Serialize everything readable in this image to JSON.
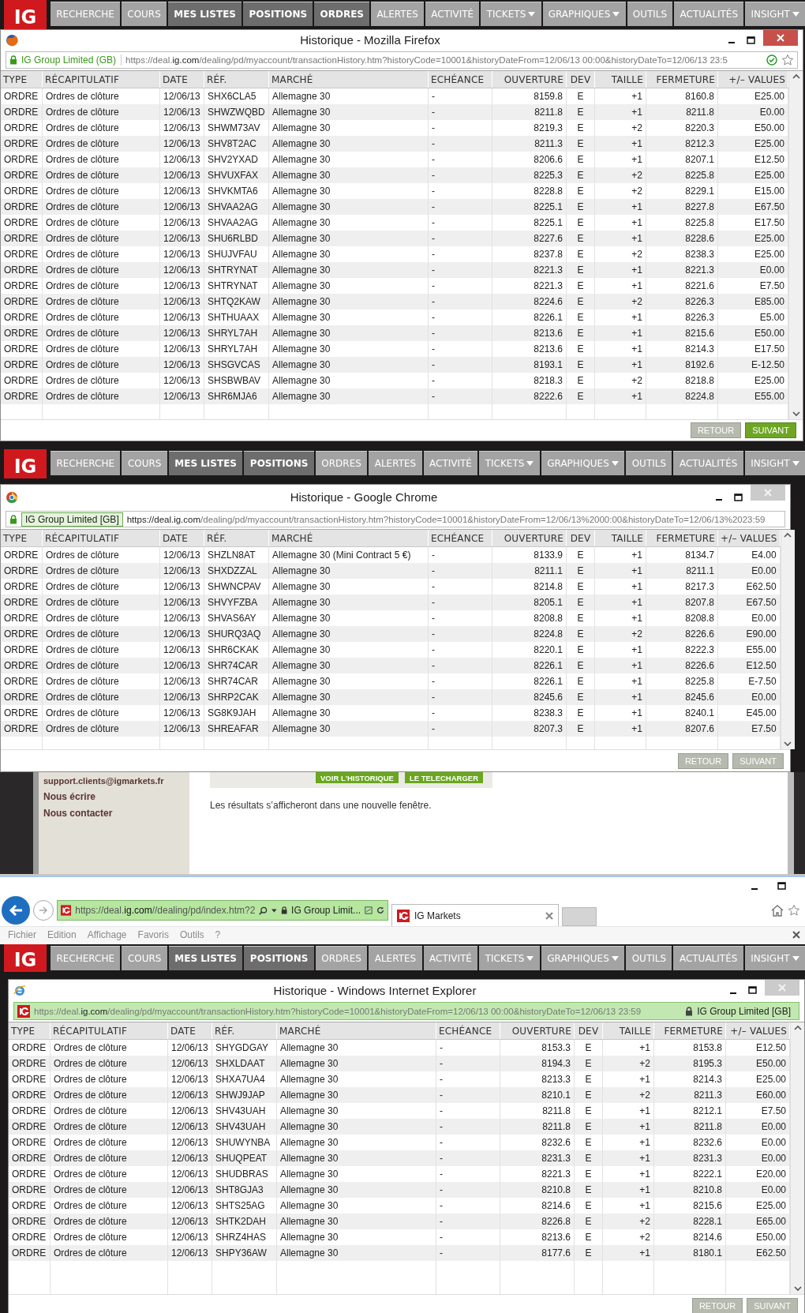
{
  "firefox_window": {
    "kind": "firefox",
    "logo": "IG",
    "nav": [
      {
        "label": "RECHERCHE",
        "kind": "light",
        "dropdown": false
      },
      {
        "label": "COURS",
        "kind": "light",
        "dropdown": false
      },
      {
        "label": "MES LISTES",
        "kind": "dark",
        "dropdown": false
      },
      {
        "label": "POSITIONS",
        "kind": "dark",
        "dropdown": false
      },
      {
        "label": "ORDRES",
        "kind": "dark",
        "dropdown": false
      },
      {
        "label": "ALERTES",
        "kind": "light",
        "dropdown": false
      },
      {
        "label": "ACTIVITÉ",
        "kind": "light",
        "dropdown": false
      },
      {
        "label": "TICKETS",
        "kind": "light",
        "dropdown": true
      },
      {
        "label": "GRAPHIQUES",
        "kind": "light",
        "dropdown": true
      },
      {
        "label": "OUTILS",
        "kind": "light",
        "dropdown": false
      },
      {
        "label": "ACTUALITÉS",
        "kind": "light",
        "dropdown": false
      },
      {
        "label": "INSIGHT",
        "kind": "light",
        "dropdown": true
      }
    ],
    "title": "Historique - Mozilla Firefox",
    "identity": "IG Group Limited (GB)",
    "url": "https://deal.**ig.com**/dealing/pd/myaccount/transactionHistory.htm?historyCode=10001&historyDateFrom=12/06/13 00:00&historyDateTo=12/06/13 23:5",
    "columns": [
      "TYPE",
      "RÉCAPITULATIF",
      "DATE",
      "RÉF.",
      "MARCHÉ",
      "ECHÉANCE",
      "OUVERTURE",
      "DEV",
      "TAILLE",
      "FERMETURE",
      "+/– VALUES"
    ],
    "rows": [
      [
        "ORDRE",
        "Ordres de clôture",
        "12/06/13",
        "SHX6CLA5",
        "Allemagne 30",
        "-",
        "8159.8",
        "E",
        "+1",
        "8160.8",
        "E25.00"
      ],
      [
        "ORDRE",
        "Ordres de clôture",
        "12/06/13",
        "SHWZWQBD",
        "Allemagne 30",
        "-",
        "8211.8",
        "E",
        "+1",
        "8211.8",
        "E0.00"
      ],
      [
        "ORDRE",
        "Ordres de clôture",
        "12/06/13",
        "SHWM73AV",
        "Allemagne 30",
        "-",
        "8219.3",
        "E",
        "+2",
        "8220.3",
        "E50.00"
      ],
      [
        "ORDRE",
        "Ordres de clôture",
        "12/06/13",
        "SHV8T2AC",
        "Allemagne 30",
        "-",
        "8211.3",
        "E",
        "+1",
        "8212.3",
        "E25.00"
      ],
      [
        "ORDRE",
        "Ordres de clôture",
        "12/06/13",
        "SHV2YXAD",
        "Allemagne 30",
        "-",
        "8206.6",
        "E",
        "+1",
        "8207.1",
        "E12.50"
      ],
      [
        "ORDRE",
        "Ordres de clôture",
        "12/06/13",
        "SHVUXFAX",
        "Allemagne 30",
        "-",
        "8225.3",
        "E",
        "+2",
        "8225.8",
        "E25.00"
      ],
      [
        "ORDRE",
        "Ordres de clôture",
        "12/06/13",
        "SHVKMTA6",
        "Allemagne 30",
        "-",
        "8228.8",
        "E",
        "+2",
        "8229.1",
        "E15.00"
      ],
      [
        "ORDRE",
        "Ordres de clôture",
        "12/06/13",
        "SHVAA2AG",
        "Allemagne 30",
        "-",
        "8225.1",
        "E",
        "+1",
        "8227.8",
        "E67.50"
      ],
      [
        "ORDRE",
        "Ordres de clôture",
        "12/06/13",
        "SHVAA2AG",
        "Allemagne 30",
        "-",
        "8225.1",
        "E",
        "+1",
        "8225.8",
        "E17.50"
      ],
      [
        "ORDRE",
        "Ordres de clôture",
        "12/06/13",
        "SHU6RLBD",
        "Allemagne 30",
        "-",
        "8227.6",
        "E",
        "+1",
        "8228.6",
        "E25.00"
      ],
      [
        "ORDRE",
        "Ordres de clôture",
        "12/06/13",
        "SHUJVFAU",
        "Allemagne 30",
        "-",
        "8237.8",
        "E",
        "+2",
        "8238.3",
        "E25.00"
      ],
      [
        "ORDRE",
        "Ordres de clôture",
        "12/06/13",
        "SHTRYNAT",
        "Allemagne 30",
        "-",
        "8221.3",
        "E",
        "+1",
        "8221.3",
        "E0.00"
      ],
      [
        "ORDRE",
        "Ordres de clôture",
        "12/06/13",
        "SHTRYNAT",
        "Allemagne 30",
        "-",
        "8221.3",
        "E",
        "+1",
        "8221.6",
        "E7.50"
      ],
      [
        "ORDRE",
        "Ordres de clôture",
        "12/06/13",
        "SHTQ2KAW",
        "Allemagne 30",
        "-",
        "8224.6",
        "E",
        "+2",
        "8226.3",
        "E85.00"
      ],
      [
        "ORDRE",
        "Ordres de clôture",
        "12/06/13",
        "SHTHUAAX",
        "Allemagne 30",
        "-",
        "8226.1",
        "E",
        "+1",
        "8226.3",
        "E5.00"
      ],
      [
        "ORDRE",
        "Ordres de clôture",
        "12/06/13",
        "SHRYL7AH",
        "Allemagne 30",
        "-",
        "8213.6",
        "E",
        "+1",
        "8215.6",
        "E50.00"
      ],
      [
        "ORDRE",
        "Ordres de clôture",
        "12/06/13",
        "SHRYL7AH",
        "Allemagne 30",
        "-",
        "8213.6",
        "E",
        "+1",
        "8214.3",
        "E17.50"
      ],
      [
        "ORDRE",
        "Ordres de clôture",
        "12/06/13",
        "SHSGVCAS",
        "Allemagne 30",
        "-",
        "8193.1",
        "E",
        "+1",
        "8192.6",
        "E-12.50"
      ],
      [
        "ORDRE",
        "Ordres de clôture",
        "12/06/13",
        "SHSBWBAV",
        "Allemagne 30",
        "-",
        "8218.3",
        "E",
        "+2",
        "8218.8",
        "E25.00"
      ],
      [
        "ORDRE",
        "Ordres de clôture",
        "12/06/13",
        "SHR6MJA6",
        "Allemagne 30",
        "-",
        "8222.6",
        "E",
        "+1",
        "8224.8",
        "E55.00"
      ]
    ],
    "buttons": [
      {
        "label": "RETOUR",
        "primary": false
      },
      {
        "label": "SUIVANT",
        "primary": true
      }
    ]
  },
  "chrome_window": {
    "kind": "chrome",
    "logo": "IG",
    "nav": [
      {
        "label": "RECHERCHE",
        "kind": "light",
        "dropdown": false
      },
      {
        "label": "COURS",
        "kind": "light",
        "dropdown": false
      },
      {
        "label": "MES LISTES",
        "kind": "dark",
        "dropdown": false
      },
      {
        "label": "POSITIONS",
        "kind": "dark",
        "dropdown": false
      },
      {
        "label": "ORDRES",
        "kind": "light",
        "dropdown": false
      },
      {
        "label": "ALERTES",
        "kind": "light",
        "dropdown": false
      },
      {
        "label": "ACTIVITÉ",
        "kind": "light",
        "dropdown": false
      },
      {
        "label": "TICKETS",
        "kind": "light",
        "dropdown": true
      },
      {
        "label": "GRAPHIQUES",
        "kind": "light",
        "dropdown": true
      },
      {
        "label": "OUTILS",
        "kind": "light",
        "dropdown": false
      },
      {
        "label": "ACTUALITÉS",
        "kind": "light",
        "dropdown": false
      },
      {
        "label": "INSIGHT",
        "kind": "light",
        "dropdown": true
      }
    ],
    "title": "Historique - Google Chrome",
    "identity": "IG Group Limited [GB]",
    "url": "**https://deal.ig.com**/dealing/pd/myaccount/transactionHistory.htm?historyCode=10001&historyDateFrom=12/06/13%2000:00&historyDateTo=12/06/13%2023:59",
    "columns": [
      "TYPE",
      "RÉCAPITULATIF",
      "DATE",
      "RÉF.",
      "MARCHÉ",
      "ECHÉANCE",
      "OUVERTURE",
      "DEV",
      "TAILLE",
      "FERMETURE",
      "+/– VALUES"
    ],
    "rows": [
      [
        "ORDRE",
        "Ordres de clôture",
        "12/06/13",
        "SHZLN8AT",
        "Allemagne 30 (Mini Contract 5 €)",
        "-",
        "8133.9",
        "E",
        "+1",
        "8134.7",
        "E4.00"
      ],
      [
        "ORDRE",
        "Ordres de clôture",
        "12/06/13",
        "SHXDZZAL",
        "Allemagne 30",
        "-",
        "8211.1",
        "E",
        "+1",
        "8211.1",
        "E0.00"
      ],
      [
        "ORDRE",
        "Ordres de clôture",
        "12/06/13",
        "SHWNCPAV",
        "Allemagne 30",
        "-",
        "8214.8",
        "E",
        "+1",
        "8217.3",
        "E62.50"
      ],
      [
        "ORDRE",
        "Ordres de clôture",
        "12/06/13",
        "SHVYFZBA",
        "Allemagne 30",
        "-",
        "8205.1",
        "E",
        "+1",
        "8207.8",
        "E67.50"
      ],
      [
        "ORDRE",
        "Ordres de clôture",
        "12/06/13",
        "SHVAS6AY",
        "Allemagne 30",
        "-",
        "8208.8",
        "E",
        "+1",
        "8208.8",
        "E0.00"
      ],
      [
        "ORDRE",
        "Ordres de clôture",
        "12/06/13",
        "SHURQ3AQ",
        "Allemagne 30",
        "-",
        "8224.8",
        "E",
        "+2",
        "8226.6",
        "E90.00"
      ],
      [
        "ORDRE",
        "Ordres de clôture",
        "12/06/13",
        "SHR6CKAK",
        "Allemagne 30",
        "-",
        "8220.1",
        "E",
        "+1",
        "8222.3",
        "E55.00"
      ],
      [
        "ORDRE",
        "Ordres de clôture",
        "12/06/13",
        "SHR74CAR",
        "Allemagne 30",
        "-",
        "8226.1",
        "E",
        "+1",
        "8226.6",
        "E12.50"
      ],
      [
        "ORDRE",
        "Ordres de clôture",
        "12/06/13",
        "SHR74CAR",
        "Allemagne 30",
        "-",
        "8226.1",
        "E",
        "+1",
        "8225.8",
        "E-7.50"
      ],
      [
        "ORDRE",
        "Ordres de clôture",
        "12/06/13",
        "SHRP2CAK",
        "Allemagne 30",
        "-",
        "8245.6",
        "E",
        "+1",
        "8245.6",
        "E0.00"
      ],
      [
        "ORDRE",
        "Ordres de clôture",
        "12/06/13",
        "SG8K9JAH",
        "Allemagne 30",
        "-",
        "8238.3",
        "E",
        "+1",
        "8240.1",
        "E45.00"
      ],
      [
        "ORDRE",
        "Ordres de clôture",
        "12/06/13",
        "SHREAFAR",
        "Allemagne 30",
        "-",
        "8207.3",
        "E",
        "+1",
        "8207.6",
        "E7.50"
      ]
    ],
    "buttons": [
      {
        "label": "RETOUR",
        "primary": false
      },
      {
        "label": "SUIVANT",
        "primary": false
      }
    ]
  },
  "page": {
    "sidebar_links": [
      "support.clients@igmarkets.fr",
      "Nous écrire",
      "Nous contacter"
    ],
    "buttons": [
      "VOIR L'HISTORIQUE",
      "LE TELECHARGER"
    ],
    "note": "Les résultats s’afficheront dans une nouvelle fenêtre."
  },
  "ie_toolbar": {
    "address": "https://deal.**ig.com**//dealing/pd/index.htm?2",
    "identity": "IG Group Limit...",
    "tab": "IG Markets",
    "menu": [
      "Fichier",
      "Edition",
      "Affichage",
      "Favoris",
      "Outils",
      "?"
    ]
  },
  "ie_window": {
    "kind": "ie",
    "logo": "IG",
    "nav": [
      {
        "label": "RECHERCHE",
        "kind": "light",
        "dropdown": false
      },
      {
        "label": "COURS",
        "kind": "light",
        "dropdown": false
      },
      {
        "label": "MES LISTES",
        "kind": "dark",
        "dropdown": false
      },
      {
        "label": "POSITIONS",
        "kind": "dark",
        "dropdown": false
      },
      {
        "label": "ORDRES",
        "kind": "light",
        "dropdown": false
      },
      {
        "label": "ALERTES",
        "kind": "light",
        "dropdown": false
      },
      {
        "label": "ACTIVITÉ",
        "kind": "light",
        "dropdown": false
      },
      {
        "label": "TICKETS",
        "kind": "light",
        "dropdown": true
      },
      {
        "label": "GRAPHIQUES",
        "kind": "light",
        "dropdown": true
      },
      {
        "label": "OUTILS",
        "kind": "light",
        "dropdown": false
      },
      {
        "label": "ACTUALITÉS",
        "kind": "light",
        "dropdown": false
      },
      {
        "label": "INSIGHT",
        "kind": "light",
        "dropdown": true
      }
    ],
    "title": "Historique - Windows Internet Explorer",
    "identity": "IG Group Limited [GB]",
    "url": "https://deal.**ig.com**/dealing/pd/myaccount/transactionHistory.htm?historyCode=10001&historyDateFrom=12/06/13 00:00&historyDateTo=12/06/13 23:59",
    "columns": [
      "TYPE",
      "RÉCAPITULATIF",
      "DATE",
      "RÉF.",
      "MARCHÉ",
      "ECHÉANCE",
      "OUVERTURE",
      "DEV",
      "TAILLE",
      "FERMETURE",
      "+/– VALUES"
    ],
    "rows": [
      [
        "ORDRE",
        "Ordres de clôture",
        "12/06/13",
        "SHYGDGAY",
        "Allemagne 30",
        "-",
        "8153.3",
        "E",
        "+1",
        "8153.8",
        "E12.50"
      ],
      [
        "ORDRE",
        "Ordres de clôture",
        "12/06/13",
        "SHXLDAAT",
        "Allemagne 30",
        "-",
        "8194.3",
        "E",
        "+2",
        "8195.3",
        "E50.00"
      ],
      [
        "ORDRE",
        "Ordres de clôture",
        "12/06/13",
        "SHXA7UA4",
        "Allemagne 30",
        "-",
        "8213.3",
        "E",
        "+1",
        "8214.3",
        "E25.00"
      ],
      [
        "ORDRE",
        "Ordres de clôture",
        "12/06/13",
        "SHWJ9JAP",
        "Allemagne 30",
        "-",
        "8210.1",
        "E",
        "+2",
        "8211.3",
        "E60.00"
      ],
      [
        "ORDRE",
        "Ordres de clôture",
        "12/06/13",
        "SHV43UAH",
        "Allemagne 30",
        "-",
        "8211.8",
        "E",
        "+1",
        "8212.1",
        "E7.50"
      ],
      [
        "ORDRE",
        "Ordres de clôture",
        "12/06/13",
        "SHV43UAH",
        "Allemagne 30",
        "-",
        "8211.8",
        "E",
        "+1",
        "8211.8",
        "E0.00"
      ],
      [
        "ORDRE",
        "Ordres de clôture",
        "12/06/13",
        "SHUWYNBA",
        "Allemagne 30",
        "-",
        "8232.6",
        "E",
        "+1",
        "8232.6",
        "E0.00"
      ],
      [
        "ORDRE",
        "Ordres de clôture",
        "12/06/13",
        "SHUQPEAT",
        "Allemagne 30",
        "-",
        "8231.3",
        "E",
        "+1",
        "8231.3",
        "E0.00"
      ],
      [
        "ORDRE",
        "Ordres de clôture",
        "12/06/13",
        "SHUDBRAS",
        "Allemagne 30",
        "-",
        "8221.3",
        "E",
        "+1",
        "8222.1",
        "E20.00"
      ],
      [
        "ORDRE",
        "Ordres de clôture",
        "12/06/13",
        "SHT8GJA3",
        "Allemagne 30",
        "-",
        "8210.8",
        "E",
        "+1",
        "8210.8",
        "E0.00"
      ],
      [
        "ORDRE",
        "Ordres de clôture",
        "12/06/13",
        "SHTS25AG",
        "Allemagne 30",
        "-",
        "8214.6",
        "E",
        "+1",
        "8215.6",
        "E25.00"
      ],
      [
        "ORDRE",
        "Ordres de clôture",
        "12/06/13",
        "SHTK2DAH",
        "Allemagne 30",
        "-",
        "8226.8",
        "E",
        "+2",
        "8228.1",
        "E65.00"
      ],
      [
        "ORDRE",
        "Ordres de clôture",
        "12/06/13",
        "SHRZ4HAS",
        "Allemagne 30",
        "-",
        "8213.6",
        "E",
        "+2",
        "8214.6",
        "E50.00"
      ],
      [
        "ORDRE",
        "Ordres de clôture",
        "12/06/13",
        "SHPY36AW",
        "Allemagne 30",
        "-",
        "8177.6",
        "E",
        "+1",
        "8180.1",
        "E62.50"
      ]
    ],
    "buttons": [
      {
        "label": "RETOUR",
        "primary": false
      },
      {
        "label": "SUIVANT",
        "primary": false
      }
    ]
  }
}
